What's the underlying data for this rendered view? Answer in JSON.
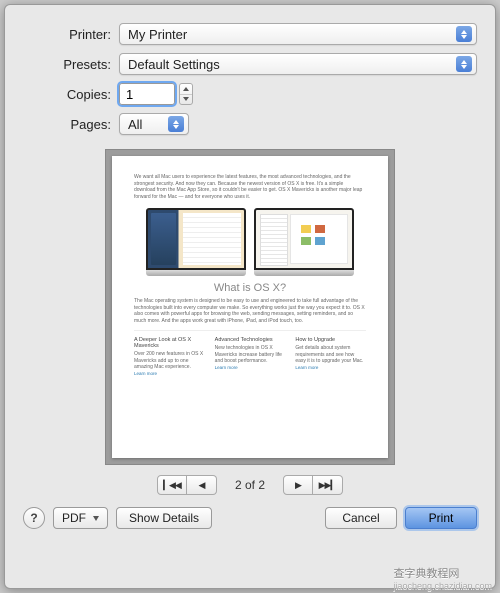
{
  "labels": {
    "printer": "Printer:",
    "presets": "Presets:",
    "copies": "Copies:",
    "pages": "Pages:"
  },
  "values": {
    "printer": "My Printer",
    "presets": "Default Settings",
    "copies": "1",
    "pages": "All"
  },
  "preview": {
    "heading": "What is OS X?",
    "col1_title": "A Deeper Look at OS X Mavericks",
    "col2_title": "Advanced Technologies",
    "col3_title": "How to Upgrade",
    "link": "Learn more"
  },
  "pager": {
    "text": "2 of 2"
  },
  "buttons": {
    "help": "?",
    "pdf": "PDF",
    "show_details": "Show Details",
    "cancel": "Cancel",
    "print": "Print"
  },
  "watermark": {
    "main": "查字典教程网",
    "sub": "jiaocheng.chazidian.com"
  }
}
